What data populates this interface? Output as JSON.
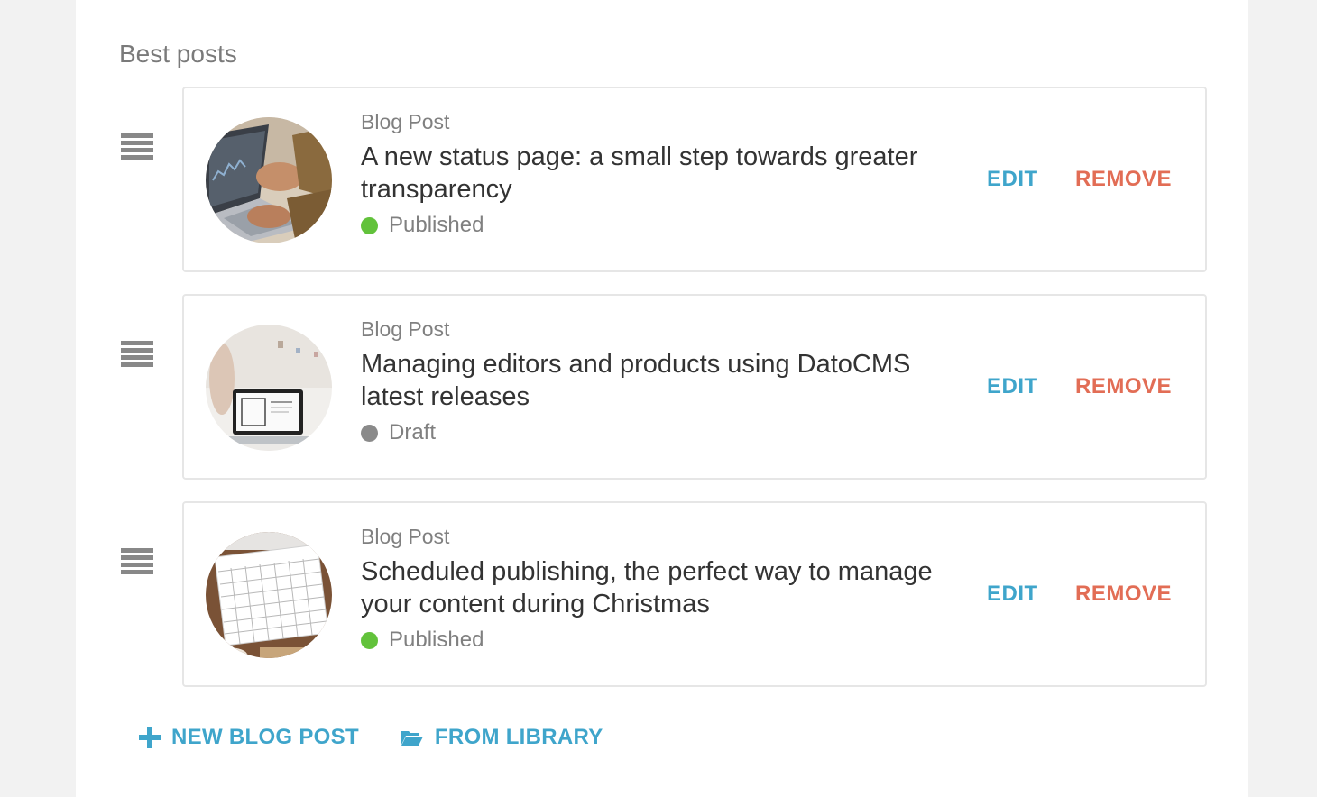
{
  "section": {
    "title": "Best posts"
  },
  "posts": [
    {
      "kind": "Blog Post",
      "title": "A new status page: a small step towards greater transparency",
      "status": "Published",
      "status_color": "#62c23b",
      "image": "laptop-typing-photo",
      "edit_label": "EDIT",
      "remove_label": "REMOVE"
    },
    {
      "kind": "Blog Post",
      "title": "Managing editors and products using DatoCMS latest releases",
      "status": "Draft",
      "status_color": "#8a8a8a",
      "image": "laptop-on-desk-photo",
      "edit_label": "EDIT",
      "remove_label": "REMOVE"
    },
    {
      "kind": "Blog Post",
      "title": "Scheduled publishing, the perfect way to manage your content during Christmas",
      "status": "Published",
      "status_color": "#62c23b",
      "image": "calendar-photo",
      "edit_label": "EDIT",
      "remove_label": "REMOVE"
    }
  ],
  "actions": {
    "new_label": "NEW BLOG POST",
    "new_icon": "plus-icon",
    "library_label": "FROM LIBRARY",
    "library_icon": "folder-open-icon"
  },
  "colors": {
    "accent": "#3fa5cb",
    "danger": "#e26d55",
    "published": "#62c23b",
    "draft": "#8a8a8a"
  }
}
